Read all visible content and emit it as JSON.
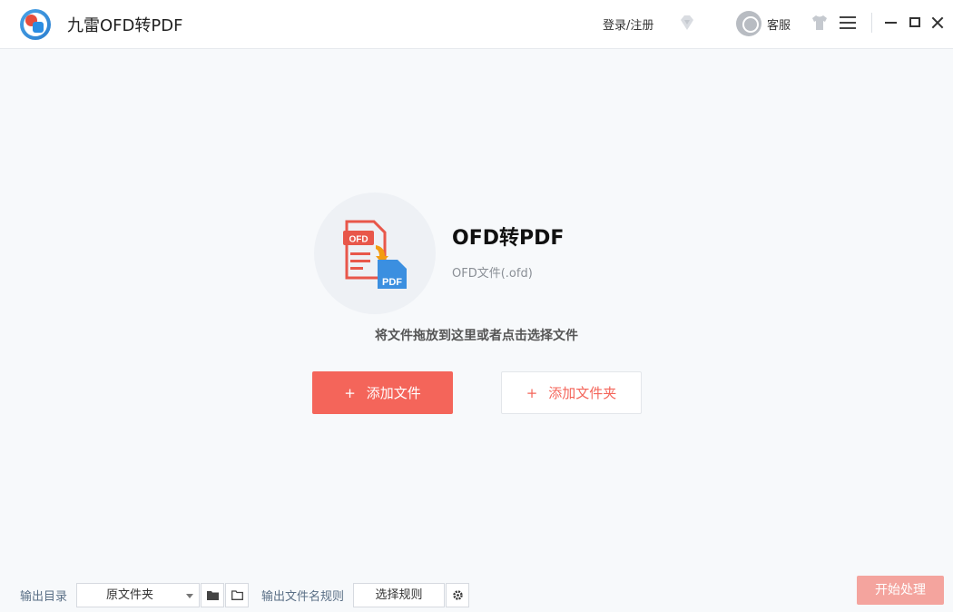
{
  "header": {
    "app_title": "九雷OFD转PDF",
    "login_label": "登录/注册",
    "support_label": "客服",
    "icons": [
      "app-logo",
      "vip-diamond-icon",
      "support-avatar",
      "skin-icon",
      "menu-icon",
      "minimize-icon",
      "maximize-icon",
      "close-icon"
    ]
  },
  "main": {
    "conversion_title": "OFD转PDF",
    "conversion_subtitle": "OFD文件(.ofd)",
    "file_icon_labels": {
      "top": "OFD",
      "bottom": "PDF"
    },
    "drop_hint": "将文件拖放到这里或者点击选择文件",
    "add_file_label": "添加文件",
    "add_folder_label": "添加文件夹",
    "plus_symbol": "+"
  },
  "footer": {
    "output_dir_label": "输出目录",
    "output_dir_value": "原文件夹",
    "filename_rule_label": "输出文件名规则",
    "choose_rule_label": "选择规则",
    "start_label": "开始处理"
  },
  "colors": {
    "accent": "#f4655a",
    "start_disabled": "#f4a49e",
    "label_blue": "#5a6f86"
  }
}
